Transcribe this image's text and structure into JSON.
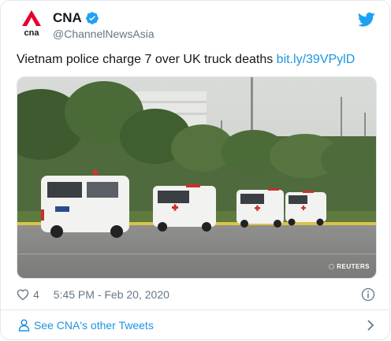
{
  "author": {
    "display_name": "CNA",
    "handle": "@ChannelNewsAsia",
    "avatar_text": "cna",
    "avatar_icon": "cna-logo-icon",
    "verified": true
  },
  "tweet": {
    "text": "Vietnam police charge 7 over UK truck deaths",
    "link": "bit.ly/39VPylD"
  },
  "photo": {
    "alt_subject": "ambulances-on-road",
    "watermark": "REUTERS"
  },
  "meta": {
    "like_count": "4",
    "timestamp": "5:45 PM - Feb 20, 2020"
  },
  "footer": {
    "label": "See CNA's other Tweets"
  },
  "colors": {
    "link": "#1b95e0",
    "brand_red": "#e4002b",
    "verified": "#1da1f2",
    "muted": "#657786"
  },
  "icons": [
    "cna-logo-icon",
    "verified-badge-icon",
    "twitter-bird-icon",
    "heart-icon",
    "info-icon",
    "person-icon",
    "chevron-right-icon"
  ]
}
